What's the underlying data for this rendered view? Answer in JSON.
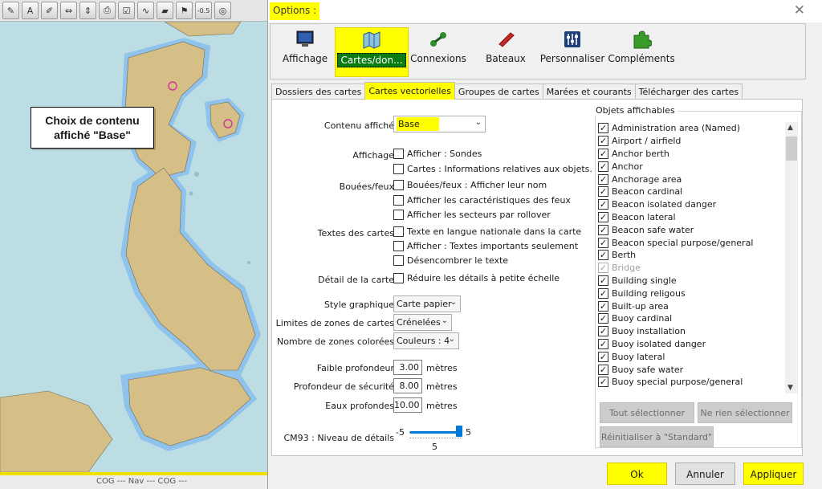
{
  "map": {
    "toolbar_icons": [
      "pencil-icon",
      "route-icon",
      "mark-icon",
      "ruler-icon",
      "track-icon",
      "print-icon",
      "form-icon",
      "tide-icon",
      "layer-icon",
      "current-icon",
      "zoom-icon",
      "lifebuoy-icon"
    ],
    "toolbar_zoom_label": "-0.5",
    "callout_line1": "Choix de contenu",
    "callout_line2": "affiché \"Base\"",
    "bottom_text": "COG ---  Nav ---  COG ---",
    "colors": {
      "sea": "#bcdde4",
      "land": "#d6bf86",
      "shallow": "#8fc3ec"
    }
  },
  "dialog": {
    "title": "Options :",
    "categories": [
      {
        "label": "Affichage",
        "icon": "monitor-icon"
      },
      {
        "label": "Cartes/don...",
        "icon": "charts-icon",
        "active": true
      },
      {
        "label": "Connexions",
        "icon": "connection-icon"
      },
      {
        "label": "Bateaux",
        "icon": "boat-icon"
      },
      {
        "label": "Personnaliser",
        "icon": "sliders-icon"
      },
      {
        "label": "Compléments",
        "icon": "puzzle-icon"
      }
    ],
    "tabs": [
      "Dossiers des cartes",
      "Cartes vectorielles",
      "Groupes de cartes",
      "Marées et courants",
      "Télécharger des cartes"
    ],
    "active_tab": 1,
    "content": {
      "contenu_label": "Contenu affiché",
      "contenu_value": "Base",
      "affichage_label": "Affichage",
      "affichage_opts": [
        "Afficher : Sondes",
        "Cartes : Informations relatives aux objets."
      ],
      "bouees_label": "Bouées/feux",
      "bouees_opts": [
        "Bouées/feux : Afficher leur nom",
        "Afficher les caractéristiques des feux",
        "Afficher les secteurs par rollover"
      ],
      "textes_label": "Textes des cartes",
      "textes_opts": [
        "Texte en langue nationale dans la carte",
        "Afficher : Textes importants seulement",
        "Désencombrer le texte"
      ],
      "detail_label": "Détail de la carte",
      "detail_opt": "Réduire les détails à petite échelle",
      "style_label": "Style graphique",
      "style_value": "Carte papier",
      "limites_label": "Limites de zones de cartes",
      "limites_value": "Crénelées",
      "zones_label": "Nombre de zones colorées",
      "zones_value": "Couleurs : 4",
      "faible_label": "Faible profondeur",
      "faible_value": "3.00",
      "securite_label": "Profondeur de sécurité",
      "securite_value": "8.00",
      "eaux_label": "Eaux profondes",
      "eaux_value": "10.00",
      "unit": "mètres",
      "cm93_label": "CM93 : Niveau de détails",
      "cm93_min": "-5",
      "cm93_max": "5",
      "cm93_value": "5",
      "cm93_level": 5
    },
    "objects": {
      "title": "Objets affichables",
      "items": [
        {
          "label": "Administration area (Named)",
          "checked": true
        },
        {
          "label": "Airport / airfield",
          "checked": true
        },
        {
          "label": "Anchor berth",
          "checked": true
        },
        {
          "label": "Anchor",
          "checked": true
        },
        {
          "label": "Anchorage area",
          "checked": true
        },
        {
          "label": "Beacon cardinal",
          "checked": true
        },
        {
          "label": "Beacon isolated danger",
          "checked": true
        },
        {
          "label": "Beacon lateral",
          "checked": true
        },
        {
          "label": "Beacon safe water",
          "checked": true
        },
        {
          "label": "Beacon special purpose/general",
          "checked": true
        },
        {
          "label": "Berth",
          "checked": true
        },
        {
          "label": "Bridge",
          "checked": true,
          "disabled": true
        },
        {
          "label": "Building single",
          "checked": true
        },
        {
          "label": "Building religous",
          "checked": true
        },
        {
          "label": "Built-up area",
          "checked": true
        },
        {
          "label": "Buoy cardinal",
          "checked": true
        },
        {
          "label": "Buoy installation",
          "checked": true
        },
        {
          "label": "Buoy isolated danger",
          "checked": true
        },
        {
          "label": "Buoy lateral",
          "checked": true
        },
        {
          "label": "Buoy safe water",
          "checked": true
        },
        {
          "label": "Buoy special purpose/general",
          "checked": true
        }
      ],
      "select_all": "Tout sélectionner",
      "select_none": "Ne rien sélectionner",
      "reset": "Réinitialiser à \"Standard\""
    },
    "buttons": {
      "ok": "Ok",
      "cancel": "Annuler",
      "apply": "Appliquer"
    }
  }
}
